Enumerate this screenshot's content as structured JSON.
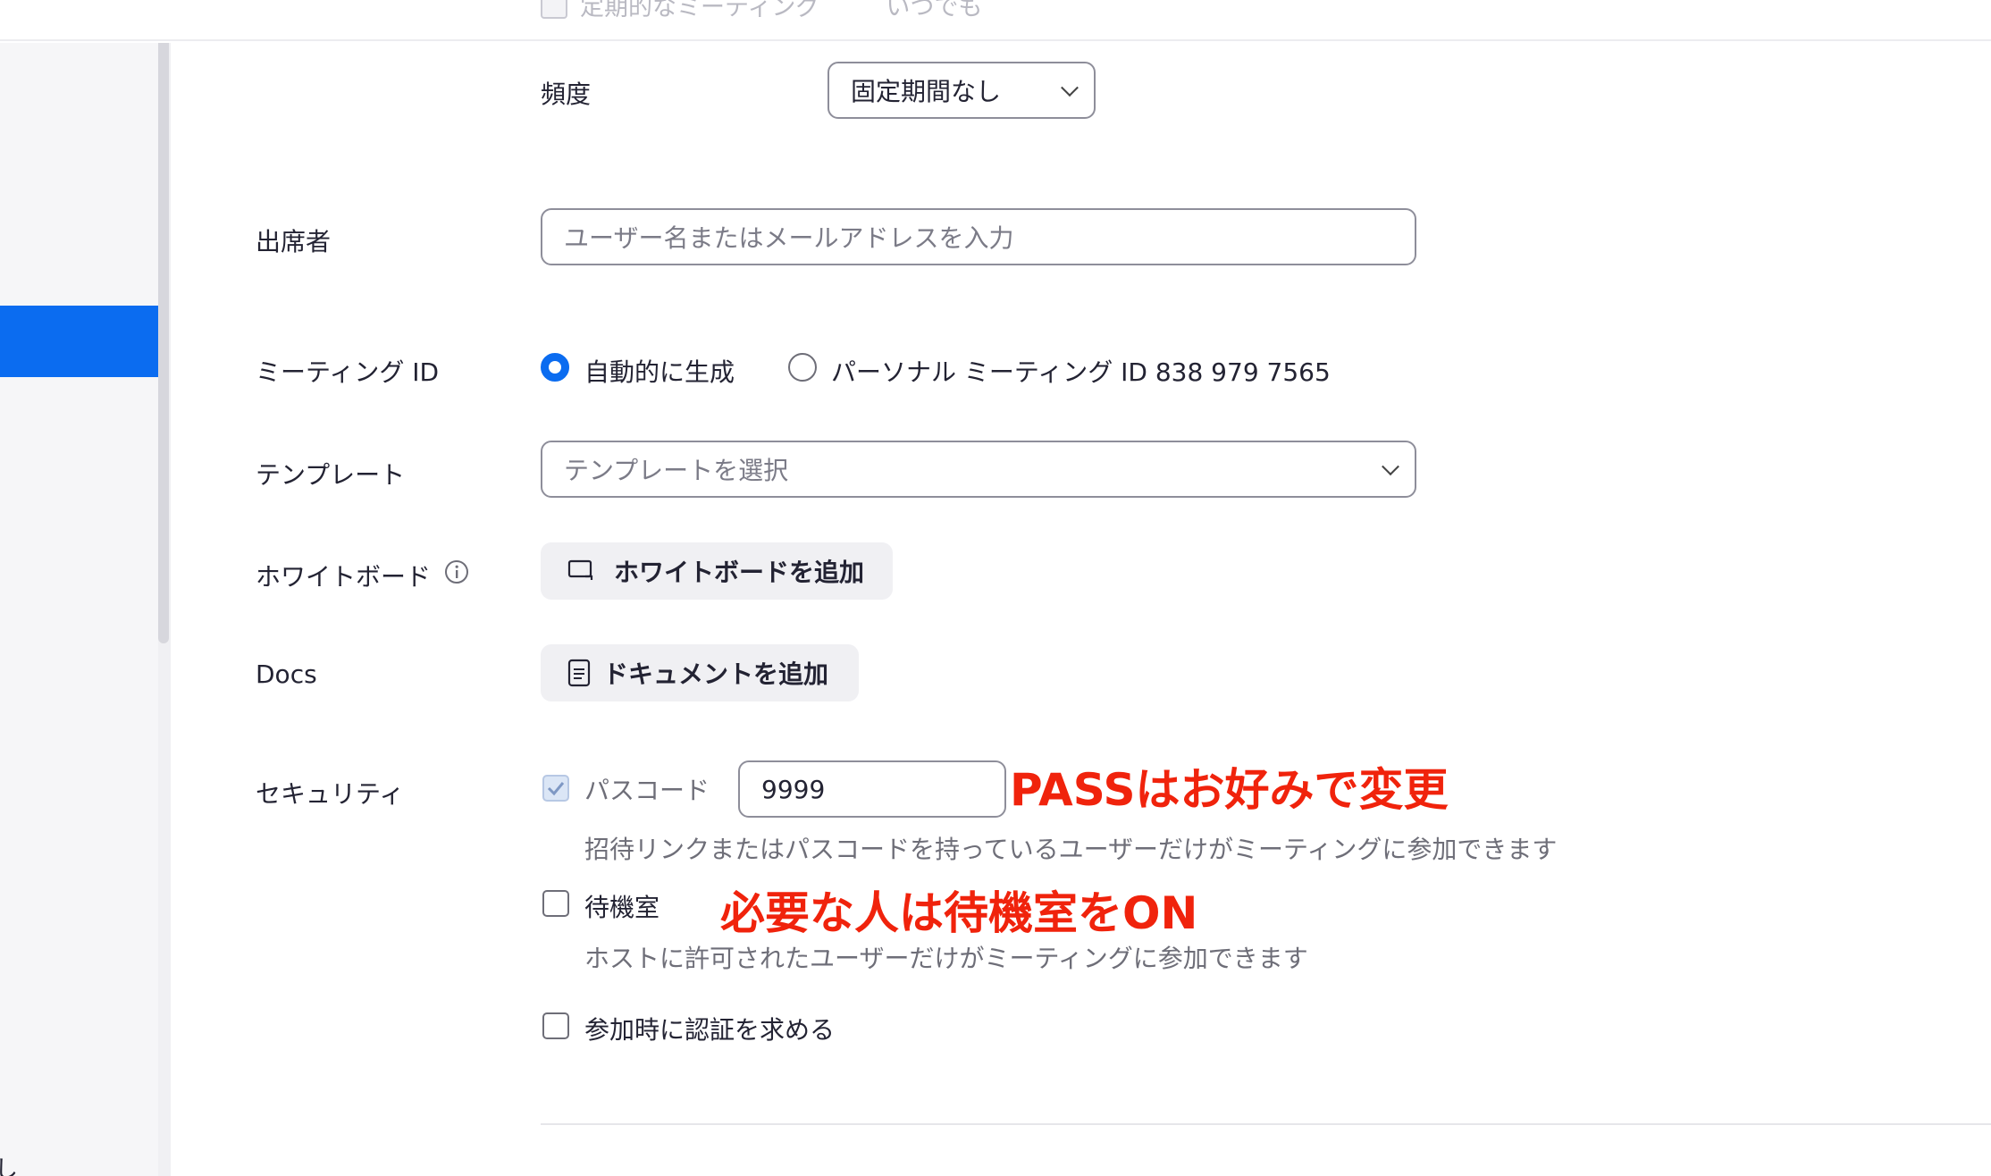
{
  "topbar": {
    "recurring_label": "定期的なミーティング",
    "recurring_value": "いつでも"
  },
  "sidebar": {
    "stub_text": "し"
  },
  "frequency": {
    "label": "頻度",
    "value": "固定期間なし"
  },
  "attendees": {
    "label": "出席者",
    "placeholder": "ユーザー名またはメールアドレスを入力"
  },
  "meeting_id": {
    "label": "ミーティング ID",
    "options": [
      "自動的に生成",
      "パーソナル ミーティング ID 838 979 7565"
    ],
    "selected": "自動的に生成"
  },
  "template": {
    "label": "テンプレート",
    "placeholder": "テンプレートを選択"
  },
  "whiteboard": {
    "label": "ホワイトボード",
    "button": "ホワイトボードを追加"
  },
  "docs": {
    "label": "Docs",
    "button": "ドキュメントを追加"
  },
  "security": {
    "label": "セキュリティ",
    "passcode": {
      "label": "パスコード",
      "value": "9999",
      "checked": true,
      "help": "招待リンクまたはパスコードを持っているユーザーだけがミーティングに参加できます"
    },
    "waiting_room": {
      "label": "待機室",
      "checked": false,
      "help": "ホストに許可されたユーザーだけがミーティングに参加できます"
    },
    "auth": {
      "label": "参加時に認証を求める",
      "checked": false
    }
  },
  "annotations": {
    "passcode_note": "PASSはお好みで変更",
    "waiting_note": "必要な人は待機室をON"
  },
  "colors": {
    "accent": "#0b6cf0",
    "annotation": "#f0230c"
  }
}
